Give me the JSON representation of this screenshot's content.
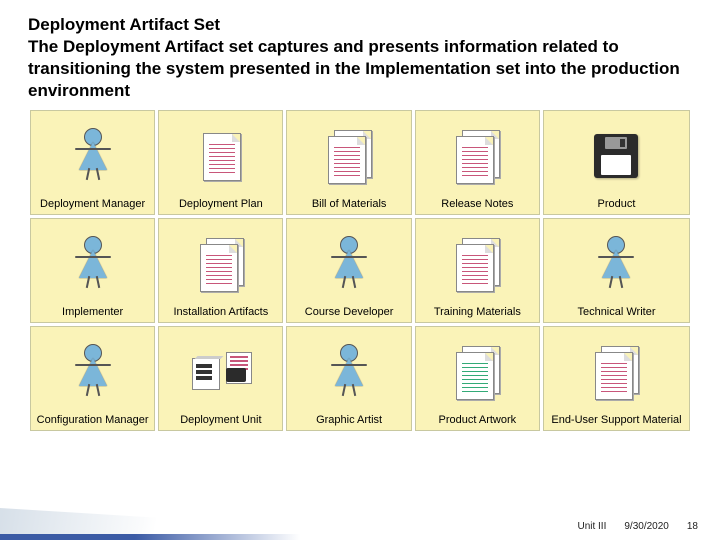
{
  "header": {
    "title": "Deployment Artifact Set",
    "desc": "The Deployment Artifact set captures and presents information related to transitioning the system presented in the Implementation set into the production environment"
  },
  "grid": {
    "rows": [
      [
        {
          "label": "Deployment Manager",
          "icon": "person"
        },
        {
          "label": "Deployment Plan",
          "icon": "doc-single"
        },
        {
          "label": "Bill of Materials",
          "icon": "doc-double"
        },
        {
          "label": "Release Notes",
          "icon": "doc-double"
        },
        {
          "label": "Product",
          "icon": "floppy"
        }
      ],
      [
        {
          "label": "Implementer",
          "icon": "person"
        },
        {
          "label": "Installation Artifacts",
          "icon": "doc-double"
        },
        {
          "label": "Course Developer",
          "icon": "person"
        },
        {
          "label": "Training Materials",
          "icon": "doc-double"
        },
        {
          "label": "Technical Writer",
          "icon": "person"
        }
      ],
      [
        {
          "label": "Configuration Manager",
          "icon": "person"
        },
        {
          "label": "Deployment Unit",
          "icon": "dep-unit"
        },
        {
          "label": "Graphic Artist",
          "icon": "person"
        },
        {
          "label": "Product Artwork",
          "icon": "doc-double"
        },
        {
          "label": "End-User Support Material",
          "icon": "doc-double"
        }
      ]
    ]
  },
  "footer": {
    "unit": "Unit III",
    "date": "9/30/2020",
    "page": "18"
  }
}
